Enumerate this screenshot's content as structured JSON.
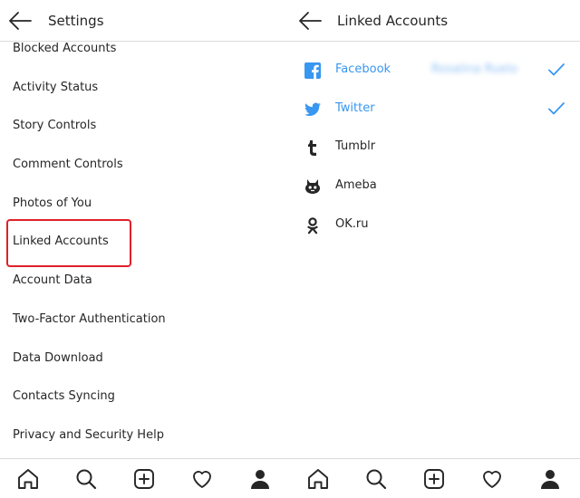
{
  "settings_panel": {
    "title": "Settings",
    "items": [
      {
        "label": "Blocked Accounts"
      },
      {
        "label": "Activity Status"
      },
      {
        "label": "Story Controls"
      },
      {
        "label": "Comment Controls"
      },
      {
        "label": "Photos of You"
      },
      {
        "label": "Linked Accounts"
      },
      {
        "label": "Account Data"
      },
      {
        "label": "Two-Factor Authentication"
      },
      {
        "label": "Data Download"
      },
      {
        "label": "Contacts Syncing"
      },
      {
        "label": "Privacy and Security Help"
      }
    ],
    "highlighted_item": "Linked Accounts",
    "highlight_color": "#e0202a"
  },
  "linked_panel": {
    "title": "Linked Accounts",
    "items": [
      {
        "label": "Facebook",
        "icon": "facebook-icon",
        "linked": true,
        "account_name": "Rosalina Ruelo"
      },
      {
        "label": "Twitter",
        "icon": "twitter-icon",
        "linked": true
      },
      {
        "label": "Tumblr",
        "icon": "tumblr-icon",
        "linked": false
      },
      {
        "label": "Ameba",
        "icon": "ameba-icon",
        "linked": false
      },
      {
        "label": "OK.ru",
        "icon": "okru-icon",
        "linked": false
      }
    ],
    "accent_color": "#3897f0"
  },
  "tab_bar": {
    "items": [
      "home-icon",
      "search-icon",
      "add-post-icon",
      "activity-heart-icon",
      "profile-icon"
    ],
    "active": "profile-icon"
  }
}
